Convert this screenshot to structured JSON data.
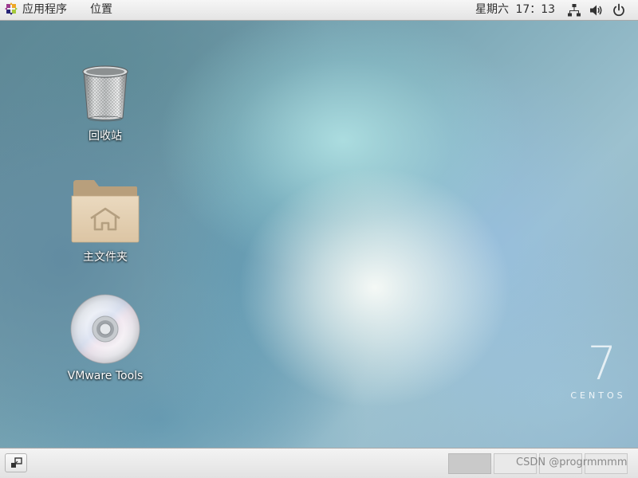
{
  "top_panel": {
    "applications_label": "应用程序",
    "places_label": "位置",
    "clock": "星期六 17：13",
    "tray_icons": [
      "network-icon",
      "volume-icon",
      "power-icon"
    ]
  },
  "desktop": {
    "icons": [
      {
        "label": "回收站",
        "icon": "trash-icon"
      },
      {
        "label": "主文件夹",
        "icon": "home-folder-icon"
      },
      {
        "label": "VMware Tools",
        "icon": "disc-icon"
      }
    ],
    "os_mark": {
      "number": "7",
      "word": "CENTOS"
    }
  },
  "bottom_panel": {
    "workspaces": 4,
    "active_workspace": 1
  },
  "watermark": "CSDN @progrmmmm"
}
